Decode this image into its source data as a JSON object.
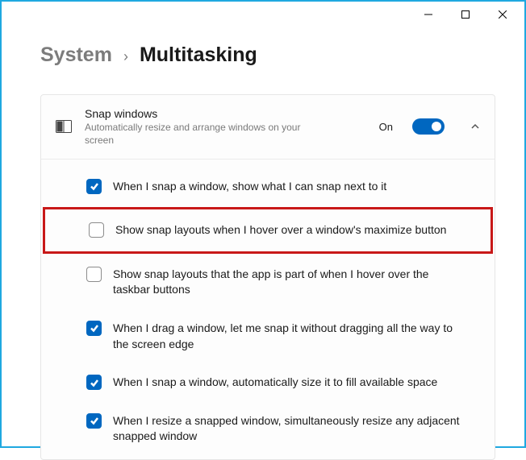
{
  "breadcrumb": {
    "parent": "System",
    "current": "Multitasking"
  },
  "snap": {
    "title": "Snap windows",
    "description": "Automatically resize and arrange windows on your screen",
    "toggle_state_label": "On",
    "toggle_on": true
  },
  "options": [
    {
      "checked": true,
      "highlighted": false,
      "label": "When I snap a window, show what I can snap next to it"
    },
    {
      "checked": false,
      "highlighted": true,
      "label": "Show snap layouts when I hover over a window's maximize button"
    },
    {
      "checked": false,
      "highlighted": false,
      "label": "Show snap layouts that the app is part of when I hover over the taskbar buttons"
    },
    {
      "checked": true,
      "highlighted": false,
      "label": "When I drag a window, let me snap it without dragging all the way to the screen edge"
    },
    {
      "checked": true,
      "highlighted": false,
      "label": "When I snap a window, automatically size it to fill available space"
    },
    {
      "checked": true,
      "highlighted": false,
      "label": "When I resize a snapped window, simultaneously resize any adjacent snapped window"
    }
  ]
}
